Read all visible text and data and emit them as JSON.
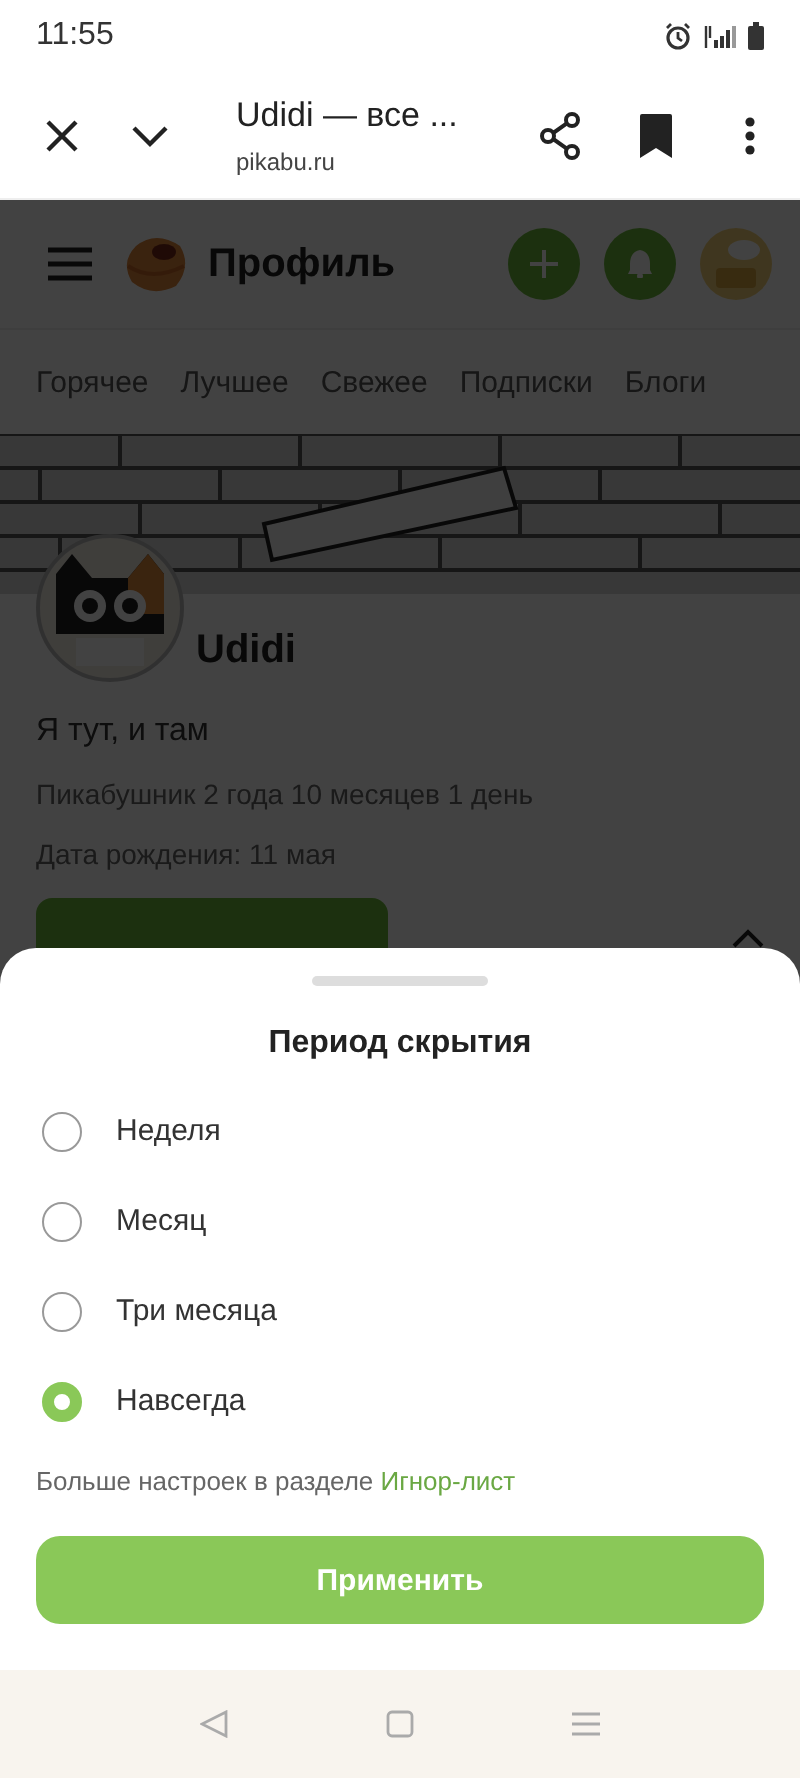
{
  "status_bar": {
    "time": "11:55"
  },
  "browser_bar": {
    "title": "Udidi — все ...",
    "url": "pikabu.ru"
  },
  "site_header": {
    "title": "Профиль"
  },
  "tabs": [
    {
      "label": "Горячее"
    },
    {
      "label": "Лучшее"
    },
    {
      "label": "Свежее"
    },
    {
      "label": "Подписки"
    },
    {
      "label": "Блоги"
    }
  ],
  "profile": {
    "name": "Udidi",
    "bio": "Я тут, и там",
    "stats": [
      "Пикабушник 2 года 10 месяцев 1 день",
      "Дата рождения: 11 мая"
    ]
  },
  "sheet": {
    "title": "Период скрытия",
    "options": [
      {
        "label": "Неделя",
        "selected": false
      },
      {
        "label": "Месяц",
        "selected": false
      },
      {
        "label": "Три месяца",
        "selected": false
      },
      {
        "label": "Навсегда",
        "selected": true
      }
    ],
    "note": {
      "text": "Больше настроек в разделе",
      "link": "Игнор-лист"
    },
    "apply_button": "Применить"
  }
}
